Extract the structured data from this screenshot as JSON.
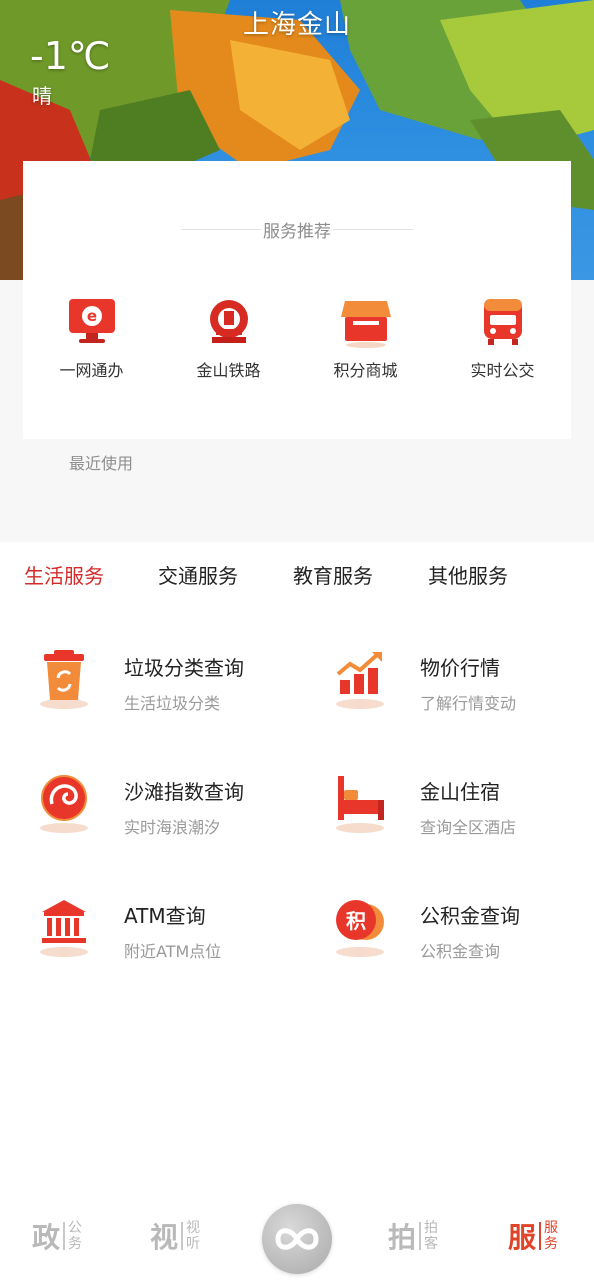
{
  "header": {
    "city": "上海金山",
    "temperature": "-1℃",
    "weather": "晴"
  },
  "recommend": {
    "title": "服务推荐",
    "items": [
      {
        "label": "一网通办",
        "icon": "e-service-icon"
      },
      {
        "label": "金山铁路",
        "icon": "railway-icon"
      },
      {
        "label": "积分商城",
        "icon": "shop-icon"
      },
      {
        "label": "实时公交",
        "icon": "bus-icon"
      }
    ],
    "recent_label": "最近使用"
  },
  "tabs": [
    {
      "label": "生活服务",
      "active": true
    },
    {
      "label": "交通服务",
      "active": false
    },
    {
      "label": "教育服务",
      "active": false
    },
    {
      "label": "其他服务",
      "active": false
    }
  ],
  "services": [
    {
      "title": "垃圾分类查询",
      "subtitle": "生活垃圾分类",
      "icon": "trash-bin-icon"
    },
    {
      "title": "物价行情",
      "subtitle": "了解行情变动",
      "icon": "price-chart-icon"
    },
    {
      "title": "沙滩指数查询",
      "subtitle": "实时海浪潮汐",
      "icon": "wave-icon"
    },
    {
      "title": "金山住宿",
      "subtitle": "查询全区酒店",
      "icon": "bed-icon"
    },
    {
      "title": "ATM查询",
      "subtitle": "附近ATM点位",
      "icon": "bank-icon"
    },
    {
      "title": "公积金查询",
      "subtitle": "公积金查询",
      "icon": "fund-icon"
    }
  ],
  "nav": [
    {
      "big": "政",
      "small_top": "公",
      "small_bottom": "务",
      "active": false
    },
    {
      "big": "视",
      "small_top": "视",
      "small_bottom": "听",
      "active": false
    },
    {
      "big": "拍",
      "small_top": "拍",
      "small_bottom": "客",
      "active": false
    },
    {
      "big": "服",
      "small_top": "服",
      "small_bottom": "务",
      "active": true
    }
  ],
  "colors": {
    "accent": "#d42a2a",
    "nav_active": "#e0452a",
    "icon_red": "#e8362b",
    "icon_orange": "#f08a3a"
  }
}
